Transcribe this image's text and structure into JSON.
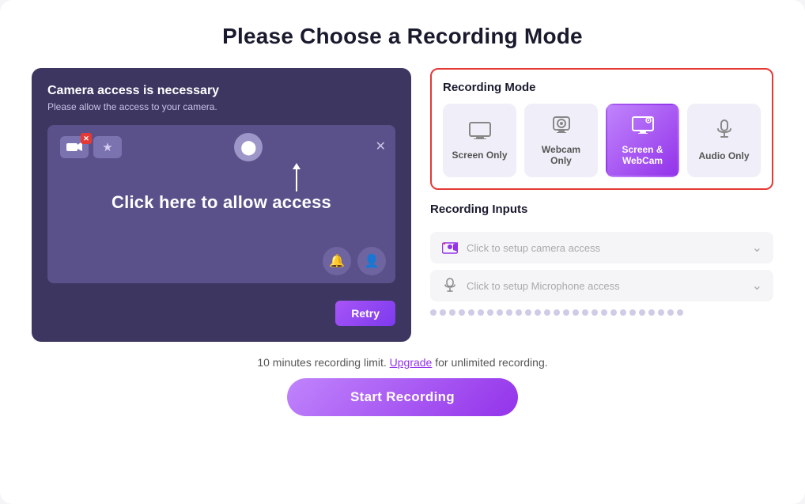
{
  "page": {
    "title": "Please Choose a Recording Mode"
  },
  "camera_panel": {
    "title": "Camera access is necessary",
    "subtitle": "Please allow the access to your camera.",
    "allow_access_text": "Click here to allow access",
    "retry_label": "Retry"
  },
  "recording_mode": {
    "section_label": "Recording Mode",
    "options": [
      {
        "id": "screen-only",
        "label": "Screen Only",
        "icon": "🖥",
        "active": false
      },
      {
        "id": "webcam-only",
        "label": "Webcam Only",
        "icon": "📷",
        "active": false
      },
      {
        "id": "screen-webcam",
        "label": "Screen & WebCam",
        "icon": "🎥",
        "active": true
      },
      {
        "id": "audio-only",
        "label": "Audio Only",
        "icon": "🎤",
        "active": false
      }
    ]
  },
  "recording_inputs": {
    "section_label": "Recording Inputs",
    "camera_placeholder": "Click to setup camera access",
    "mic_placeholder": "Click to setup Microphone access"
  },
  "footer": {
    "limit_text": "10 minutes recording limit.",
    "upgrade_label": "Upgrade",
    "upgrade_suffix": " for unlimited recording.",
    "start_label": "Start Recording"
  }
}
